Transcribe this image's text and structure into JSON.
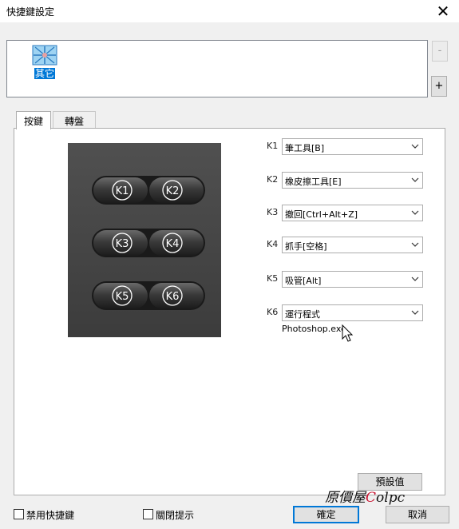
{
  "window": {
    "title": "快捷鍵設定",
    "close_glyph": "✕"
  },
  "app_list": {
    "items": [
      {
        "label": "其它",
        "icon": "app-star-icon",
        "selected": true
      }
    ],
    "remove_label": "-",
    "add_label": "+"
  },
  "tabs": [
    {
      "label": "按鍵",
      "active": true
    },
    {
      "label": "轉盤",
      "active": false
    }
  ],
  "keypad": {
    "keys": [
      "K1",
      "K2",
      "K3",
      "K4",
      "K5",
      "K6"
    ]
  },
  "key_settings": [
    {
      "key": "K1",
      "value": "筆工具[B]"
    },
    {
      "key": "K2",
      "value": "橡皮擦工具[E]"
    },
    {
      "key": "K3",
      "value": "撤回[Ctrl+Alt+Z]"
    },
    {
      "key": "K4",
      "value": "抓手[空格]"
    },
    {
      "key": "K5",
      "value": "吸管[Alt]"
    },
    {
      "key": "K6",
      "value": "運行程式",
      "extra": "Photoshop.exe"
    }
  ],
  "buttons": {
    "reset": "預設值",
    "ok": "確定",
    "cancel": "取消"
  },
  "checkboxes": [
    {
      "label": "禁用快捷鍵",
      "checked": false
    },
    {
      "label": "關閉提示",
      "checked": false
    }
  ],
  "watermark": {
    "prefix": "原價屋",
    "accent": "C",
    "suffix": "olpc"
  },
  "colors": {
    "selection": "#0078d7",
    "pad_bg": "#474747",
    "button_bg": "#e1e1e1"
  }
}
